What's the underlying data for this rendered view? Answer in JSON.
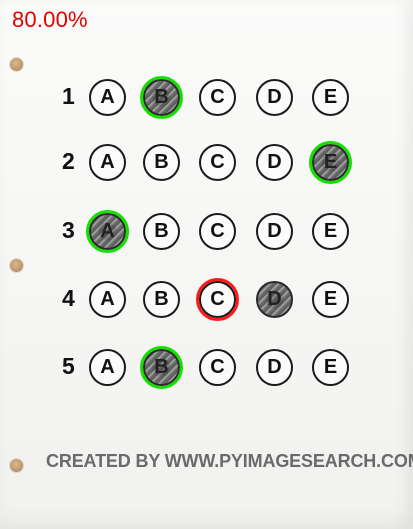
{
  "score_text": "80.00%",
  "colors": {
    "score": "#e60000",
    "correct": "#14e000",
    "wrong": "#ff1a1a",
    "footer": "#6a6a6a"
  },
  "questions": [
    {
      "number": "1",
      "options": [
        "A",
        "B",
        "C",
        "D",
        "E"
      ],
      "filled": [
        "B"
      ],
      "ring": {
        "option": "B",
        "status": "correct"
      }
    },
    {
      "number": "2",
      "options": [
        "A",
        "B",
        "C",
        "D",
        "E"
      ],
      "filled": [
        "E"
      ],
      "ring": {
        "option": "E",
        "status": "correct"
      }
    },
    {
      "number": "3",
      "options": [
        "A",
        "B",
        "C",
        "D",
        "E"
      ],
      "filled": [
        "A"
      ],
      "ring": {
        "option": "A",
        "status": "correct"
      }
    },
    {
      "number": "4",
      "options": [
        "A",
        "B",
        "C",
        "D",
        "E"
      ],
      "filled": [
        "D"
      ],
      "ring": {
        "option": "C",
        "status": "wrong"
      }
    },
    {
      "number": "5",
      "options": [
        "A",
        "B",
        "C",
        "D",
        "E"
      ],
      "filled": [
        "B"
      ],
      "ring": {
        "option": "B",
        "status": "correct"
      }
    }
  ],
  "footer_text": "CREATED BY WWW.PYIMAGESEARCH.COM"
}
